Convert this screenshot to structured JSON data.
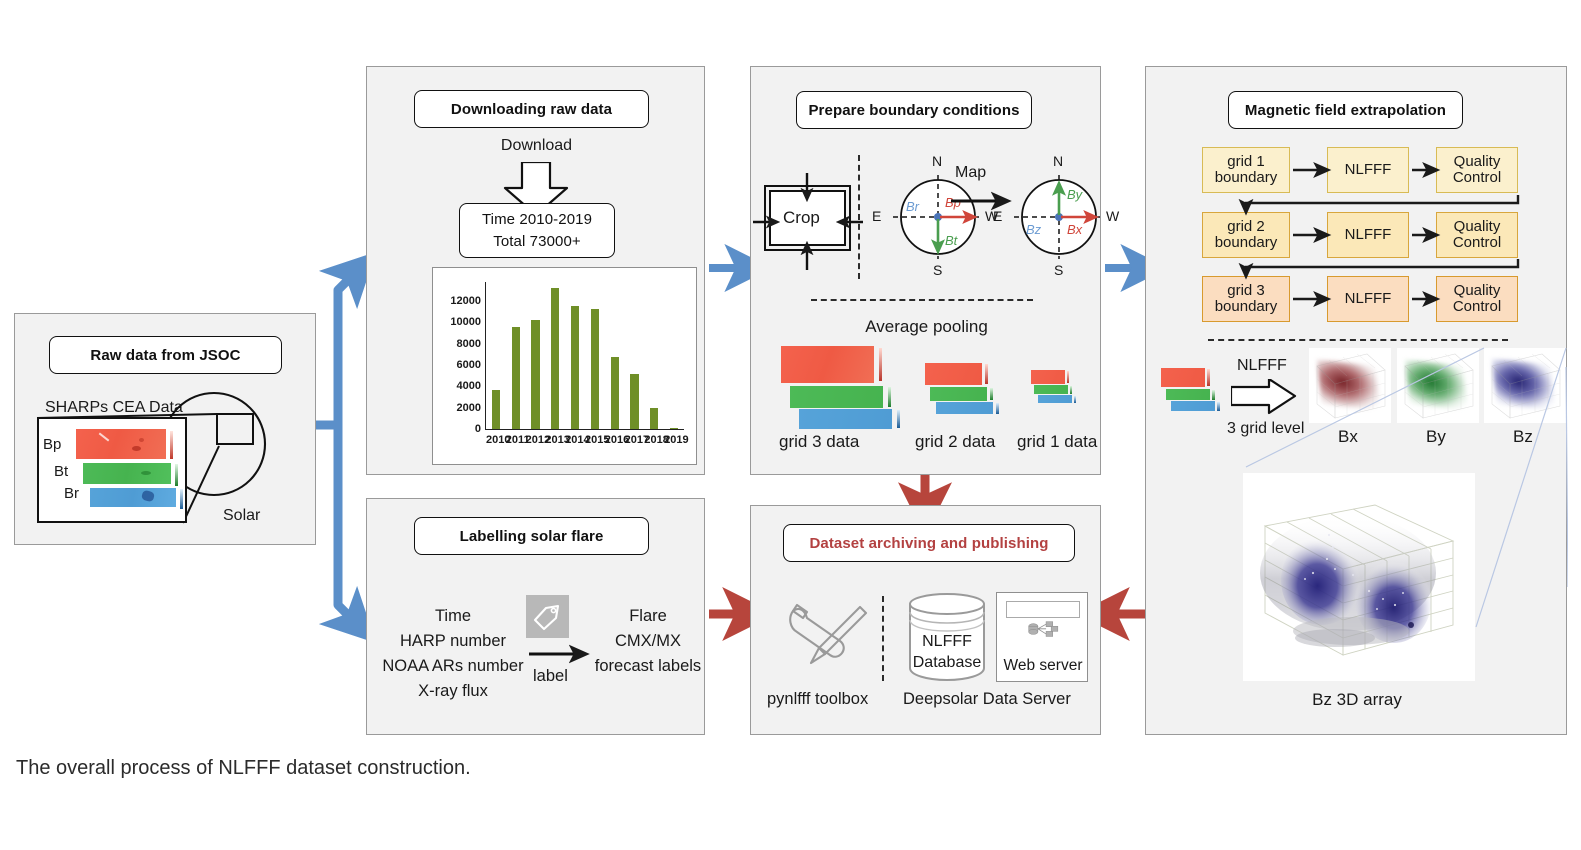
{
  "caption": "The overall process of NLFFF dataset construction.",
  "colors": {
    "panel_bg": "#f2f2f2",
    "panel_border": "#9a9a9a",
    "arrow_blue": "#5b8fc9",
    "arrow_red": "#b7453c",
    "title_red": "#b34141",
    "bar_green": "#6f8f27",
    "grid1_fill": "#fbf0cd",
    "grid2_fill": "#fbe8b8",
    "grid3_fill": "#fbddc0",
    "grid_border": "#c9a227",
    "bp_red": "#f4624d",
    "bt_green": "#4dba57",
    "br_blue": "#56a3d9"
  },
  "panels": {
    "raw": {
      "title": "Raw data from JSOC",
      "subtitle": "SHARPs CEA Data",
      "solar_label": "Solar",
      "components": [
        "Bp",
        "Bt",
        "Br"
      ]
    },
    "download": {
      "title": "Downloading raw data",
      "download_label": "Download",
      "time_line1": "Time 2010-2019",
      "time_line2": "Total  73000+"
    },
    "boundary": {
      "title": "Prepare boundary conditions",
      "crop_label": "Crop",
      "map_label": "Map",
      "pooling_label": "Average pooling",
      "compass_left": {
        "n": "N",
        "s": "S",
        "e": "E",
        "w": "W",
        "radial": "Br",
        "pos": "Bp",
        "tan": "Bt"
      },
      "compass_right": {
        "n": "N",
        "s": "S",
        "e": "E",
        "w": "W",
        "y": "By",
        "z": "Bz",
        "x": "Bx"
      },
      "grid_labels": [
        "grid 3 data",
        "grid 2 data",
        "grid 1 data"
      ]
    },
    "extrapolation": {
      "title": "Magnetic field extrapolation",
      "rows": [
        {
          "boundary": "grid 1\nboundary",
          "b1": "grid 1",
          "b2": "boundary",
          "solver": "NLFFF",
          "qc1": "Quality",
          "qc2": "Control"
        },
        {
          "boundary": "grid 2\nboundary",
          "b1": "grid 2",
          "b2": "boundary",
          "solver": "NLFFF",
          "qc1": "Quality",
          "qc2": "Control"
        },
        {
          "boundary": "grid 3\nboundary",
          "b1": "grid 3",
          "b2": "boundary",
          "solver": "NLFFF",
          "qc1": "Quality",
          "qc2": "Control"
        }
      ],
      "nlfff_arrow_label": "NLFFF",
      "grid_level_label": "3 grid level",
      "cube_labels": [
        "Bx",
        "By",
        "Bz"
      ],
      "bz3d_label": "Bz  3D  array"
    },
    "labelling": {
      "title": "Labelling solar flare",
      "inputs": [
        "Time",
        "HARP number",
        "NOAA ARs number",
        "X-ray flux"
      ],
      "arrow_label": "label",
      "outputs": [
        "Flare",
        "CMX/MX",
        "forecast labels"
      ]
    },
    "archiving": {
      "title": "Dataset archiving and publishing",
      "toolbox_label": "pynlfff toolbox",
      "server_label": "Deepsolar Data Server",
      "db_line1": "NLFFF",
      "db_line2": "Database",
      "web_label": "Web server"
    }
  },
  "chart_data": {
    "type": "bar",
    "title": "",
    "xlabel": "",
    "ylabel": "",
    "categories": [
      "2010",
      "2011",
      "2012",
      "2013",
      "2014",
      "2015",
      "2016",
      "2017",
      "2018",
      "2019"
    ],
    "values": [
      3650,
      9550,
      10200,
      13250,
      11550,
      11250,
      6800,
      5200,
      1950,
      100
    ],
    "yticks": [
      0,
      2000,
      4000,
      6000,
      8000,
      10000,
      12000
    ],
    "ylim": [
      0,
      13800
    ],
    "grid": false,
    "legend": false,
    "color": "#6f8f27"
  }
}
